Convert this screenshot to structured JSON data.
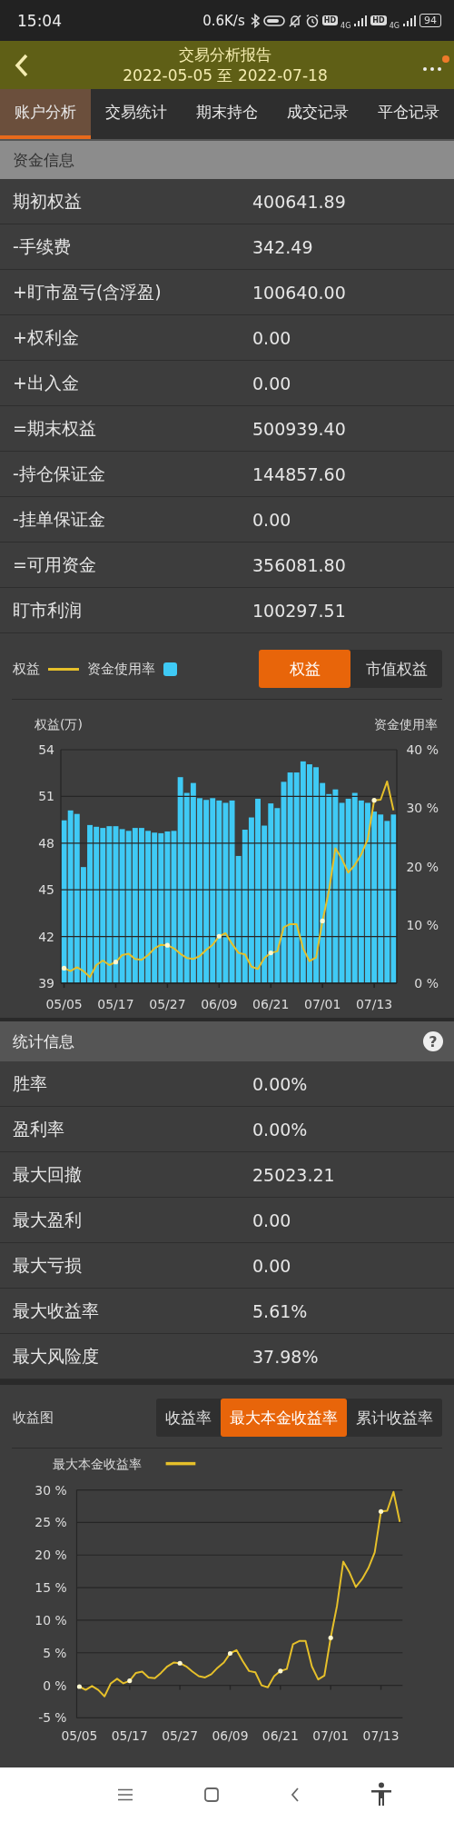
{
  "status_bar": {
    "time": "15:04",
    "speed": "0.6K/s",
    "signals": [
      {
        "hd": "HD",
        "network": "4G"
      },
      {
        "hd": "HD",
        "network": "4G"
      }
    ],
    "battery": "94"
  },
  "header": {
    "title": "交易分析报告",
    "subtitle": "2022-05-05 至 2022-07-18",
    "notification_dot": true
  },
  "tabs": [
    {
      "label": "账户分析",
      "selected": true
    },
    {
      "label": "交易统计",
      "selected": false
    },
    {
      "label": "期末持仓",
      "selected": false
    },
    {
      "label": "成交记录",
      "selected": false
    },
    {
      "label": "平仓记录",
      "selected": false
    }
  ],
  "funds": {
    "title": "资金信息",
    "rows": [
      {
        "label": "期初权益",
        "value": "400641.89"
      },
      {
        "label": "-手续费",
        "value": "342.49"
      },
      {
        "label": "+盯市盈亏(含浮盈)",
        "value": "100640.00"
      },
      {
        "label": "+权利金",
        "value": "0.00"
      },
      {
        "label": "+出入金",
        "value": "0.00"
      },
      {
        "label": "=期末权益",
        "value": "500939.40"
      },
      {
        "label": "-持仓保证金",
        "value": "144857.60"
      },
      {
        "label": "-挂单保证金",
        "value": "0.00"
      },
      {
        "label": "=可用资金",
        "value": "356081.80"
      },
      {
        "label": "盯市利润",
        "value": "100297.51"
      }
    ]
  },
  "equity_panel": {
    "toggles": [
      {
        "label": "权益",
        "selected": true
      },
      {
        "label": "市值权益",
        "selected": false
      }
    ],
    "equity_line": {
      "chart_data": {
        "type": "line",
        "grid": true,
        "ylabel": "权益(万)",
        "ylim": [
          39,
          54
        ],
        "yticks": [
          39,
          42,
          45,
          48,
          51,
          54
        ],
        "categories": [
          "05/05",
          null,
          null,
          null,
          null,
          null,
          null,
          null,
          "05/17",
          null,
          null,
          null,
          null,
          null,
          null,
          null,
          "05/27",
          null,
          null,
          null,
          null,
          null,
          null,
          null,
          "06/09",
          null,
          null,
          null,
          null,
          null,
          null,
          null,
          "06/21",
          null,
          null,
          null,
          null,
          null,
          null,
          null,
          "07/01",
          null,
          null,
          null,
          null,
          null,
          null,
          null,
          "07/13",
          null,
          null,
          null
        ],
        "series": [
          {
            "name": "权益",
            "color": "#e6c02a",
            "values": [
              39.97,
              39.78,
              40.03,
              39.78,
              39.39,
              40.17,
              40.46,
              40.17,
              40.36,
              40.81,
              40.89,
              40.56,
              40.5,
              40.81,
              41.24,
              41.47,
              41.44,
              41.24,
              40.89,
              40.62,
              40.56,
              40.75,
              41.14,
              41.47,
              42.02,
              42.21,
              41.53,
              40.95,
              40.85,
              40.07,
              39.92,
              40.62,
              40.95,
              41.05,
              42.6,
              42.8,
              42.8,
              41.24,
              40.42,
              40.66,
              43.0,
              44.94,
              47.67,
              46.99,
              46.11,
              46.6,
              47.28,
              48.25,
              50.75,
              50.79,
              51.96,
              50.1
            ]
          }
        ]
      }
    },
    "usage_bars": {
      "chart_data": {
        "type": "bar",
        "ylabel": "资金使用率",
        "ylim": [
          0,
          40
        ],
        "yticks": [
          {
            "value": 0,
            "label": "0 %"
          },
          {
            "value": 10,
            "label": "10 %"
          },
          {
            "value": 20,
            "label": "20 %"
          },
          {
            "value": 30,
            "label": "30 %"
          },
          {
            "value": 40,
            "label": "40 %"
          }
        ],
        "series": [
          {
            "name": "资金使用率",
            "color": "#3fcaf5",
            "values": [
              27.9,
              29.6,
              29.0,
              19.9,
              27.1,
              26.8,
              26.6,
              26.9,
              26.9,
              26.4,
              26.1,
              26.6,
              26.6,
              26.1,
              25.8,
              25.7,
              26.0,
              26.1,
              35.3,
              32.6,
              34.3,
              31.7,
              31.4,
              31.7,
              31.3,
              30.9,
              31.3,
              21.8,
              26.3,
              28.4,
              31.6,
              27.0,
              30.8,
              30.0,
              34.5,
              36.1,
              36.1,
              38.0,
              37.5,
              37.0,
              34.3,
              32.4,
              33.2,
              30.9,
              31.6,
              32.6,
              31.3,
              30.9,
              29.4,
              28.9,
              27.8,
              28.9
            ]
          }
        ]
      }
    }
  },
  "stats": {
    "title": "统计信息",
    "help": "?",
    "rows": [
      {
        "label": "胜率",
        "value": "0.00%"
      },
      {
        "label": "盈利率",
        "value": "0.00%"
      },
      {
        "label": "最大回撤",
        "value": "25023.21"
      },
      {
        "label": "最大盈利",
        "value": "0.00"
      },
      {
        "label": "最大亏损",
        "value": "0.00"
      },
      {
        "label": "最大收益率",
        "value": "5.61%"
      },
      {
        "label": "最大风险度",
        "value": "37.98%"
      }
    ]
  },
  "return_panel": {
    "title": "收益图",
    "tabs": [
      {
        "label": "收益率",
        "selected": false
      },
      {
        "label": "最大本金收益率",
        "selected": true
      },
      {
        "label": "累计收益率",
        "selected": false
      }
    ],
    "chart_data": {
      "type": "line",
      "grid": true,
      "categories": [
        "05/05",
        null,
        null,
        null,
        null,
        null,
        null,
        null,
        "05/17",
        null,
        null,
        null,
        null,
        null,
        null,
        null,
        "05/27",
        null,
        null,
        null,
        null,
        null,
        null,
        null,
        "06/09",
        null,
        null,
        null,
        null,
        null,
        null,
        null,
        "06/21",
        null,
        null,
        null,
        null,
        null,
        null,
        null,
        "07/01",
        null,
        null,
        null,
        null,
        null,
        null,
        null,
        "07/13",
        null,
        null,
        null
      ],
      "ylim": [
        -5,
        30
      ],
      "yticks": [
        {
          "value": -5,
          "label": "-5 %"
        },
        {
          "value": 0,
          "label": "0 %"
        },
        {
          "value": 5,
          "label": "5 %"
        },
        {
          "value": 10,
          "label": "10 %"
        },
        {
          "value": 15,
          "label": "15 %"
        },
        {
          "value": 20,
          "label": "20 %"
        },
        {
          "value": 25,
          "label": "25 %"
        },
        {
          "value": 30,
          "label": "30 %"
        }
      ],
      "series": [
        {
          "name": "最大本金收益率",
          "color": "#e6c02a",
          "values": [
            -0.2,
            -0.7,
            -0.1,
            -0.7,
            -1.7,
            0.3,
            1.0,
            0.3,
            0.7,
            1.9,
            2.1,
            1.2,
            1.1,
            1.9,
            2.9,
            3.5,
            3.4,
            2.9,
            2.1,
            1.4,
            1.2,
            1.7,
            2.7,
            3.5,
            4.9,
            5.4,
            3.7,
            2.2,
            2.0,
            0.0,
            -0.3,
            1.4,
            2.2,
            2.5,
            6.3,
            6.8,
            6.8,
            2.9,
            0.9,
            1.5,
            7.3,
            12.2,
            19.0,
            17.3,
            15.1,
            16.3,
            18.0,
            20.4,
            26.7,
            26.8,
            29.7,
            25.1
          ]
        }
      ]
    }
  }
}
